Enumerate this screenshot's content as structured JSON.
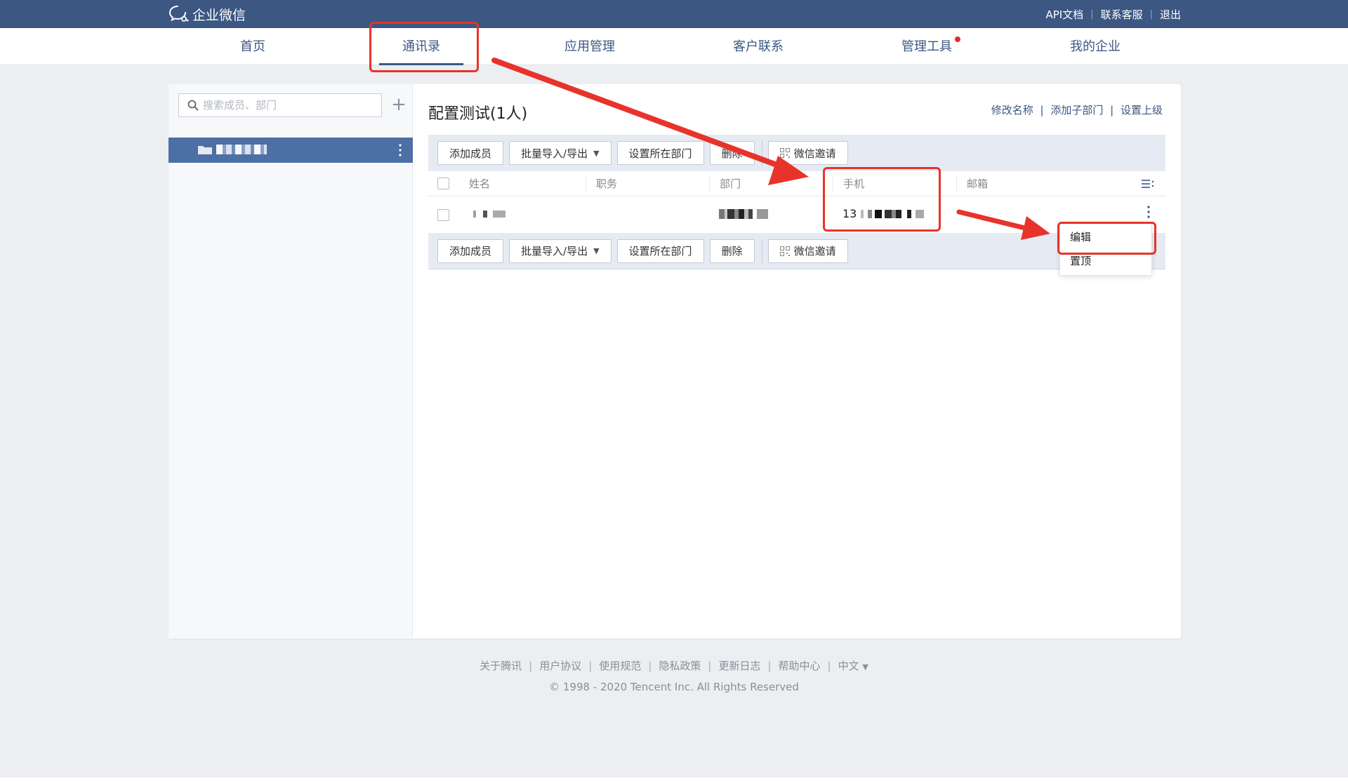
{
  "topbar": {
    "brand": "企业微信",
    "links": [
      "API文档",
      "联系客服",
      "退出"
    ]
  },
  "nav": {
    "items": [
      "首页",
      "通讯录",
      "应用管理",
      "客户联系",
      "管理工具",
      "我的企业"
    ],
    "active_index": 1
  },
  "sidebar": {
    "search_placeholder": "搜索成员、部门"
  },
  "content": {
    "title": "配置测试(1人)",
    "head_links": [
      "修改名称",
      "添加子部门",
      "设置上级"
    ],
    "toolbar": {
      "add_member": "添加成员",
      "batch_import_export": "批量导入/导出",
      "set_department": "设置所在部门",
      "delete": "删除",
      "wechat_invite": "微信邀请"
    },
    "table": {
      "headers": [
        "姓名",
        "职务",
        "部门",
        "手机",
        "邮箱"
      ],
      "rows": [
        {
          "phone_prefix": "13"
        }
      ]
    },
    "row_menu": [
      "编辑",
      "置顶"
    ]
  },
  "footer": {
    "links": [
      "关于腾讯",
      "用户协议",
      "使用规范",
      "隐私政策",
      "更新日志",
      "帮助中心"
    ],
    "language": "中文",
    "copyright": "© 1998 - 2020 Tencent Inc. All Rights Reserved"
  },
  "colors": {
    "brand_bar": "#3b5782",
    "selected_dept": "#4c6fa5",
    "annotation": "#e8332b"
  }
}
